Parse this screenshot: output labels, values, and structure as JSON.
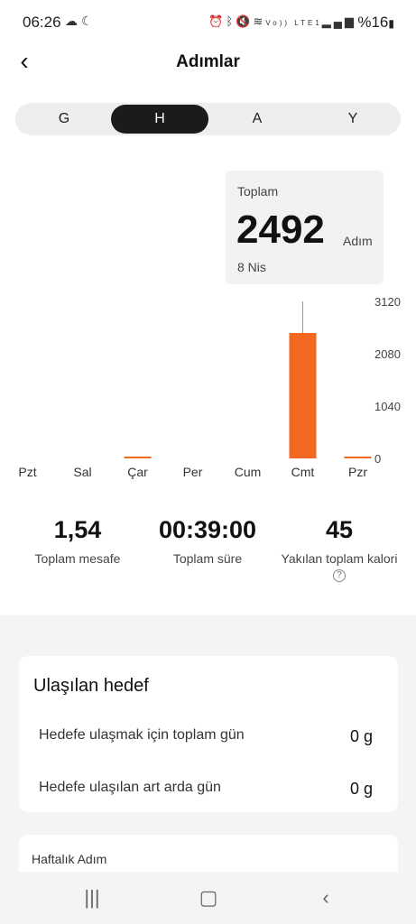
{
  "status_bar": {
    "time": "06:26",
    "left_icons": [
      "cloud-icon",
      "moon-icon"
    ],
    "right_icons": [
      "alarm-icon",
      "bluetooth-icon",
      "mute-icon",
      "wifi-icon",
      "volte-icon",
      "signal-icon"
    ],
    "battery": "%16"
  },
  "header": {
    "title": "Adımlar"
  },
  "period_tabs": [
    {
      "label": "G",
      "active": false
    },
    {
      "label": "H",
      "active": true
    },
    {
      "label": "A",
      "active": false
    },
    {
      "label": "Y",
      "active": false
    }
  ],
  "tooltip": {
    "label": "Toplam",
    "value": "2492",
    "unit": "Adım",
    "date": "8 Nis"
  },
  "chart_data": {
    "type": "bar",
    "categories": [
      "Pzt",
      "Sal",
      "Çar",
      "Per",
      "Cum",
      "Cmt",
      "Pzr"
    ],
    "values": [
      0,
      0,
      20,
      0,
      0,
      2492,
      5
    ],
    "selected_category": "Cmt",
    "y_ticks": [
      "3120",
      "2080",
      "1040",
      "0"
    ],
    "ylim": [
      0,
      3120
    ],
    "bar_color": "#f2681f",
    "title": "",
    "xlabel": "",
    "ylabel": ""
  },
  "metrics": [
    {
      "value": "1,54",
      "label": "Toplam mesafe"
    },
    {
      "value": "00:39:00",
      "label": "Toplam süre"
    },
    {
      "value": "45",
      "label": "Yakılan toplam kalori"
    }
  ],
  "goal_card": {
    "title": "Ulaşılan hedef",
    "rows": [
      {
        "label": "Hedefe ulaşmak için toplam gün",
        "value": "0 g"
      },
      {
        "label": "Hedefe ulaşılan art arda gün",
        "value": "0 g"
      }
    ]
  },
  "weekly_card": {
    "title": "Haftalık Adım"
  },
  "colors": {
    "accent": "#f2681f",
    "active_tab_bg": "#1b1b1b",
    "page_bg": "#f4f4f4"
  }
}
